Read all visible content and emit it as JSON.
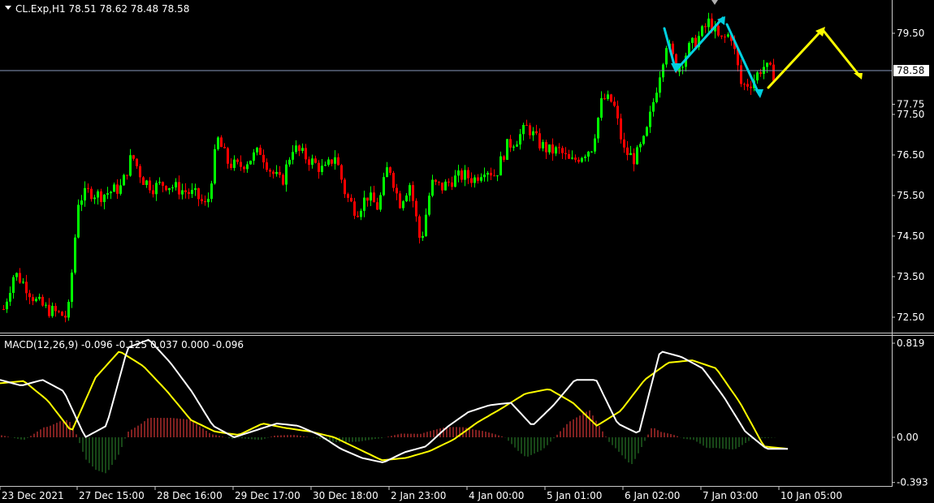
{
  "header": {
    "symbol_info": "CL.Exp,H1  78.51 78.62 78.48 78.58",
    "macd_info": "MACD(12,26,9) -0.096 -0.125 0.037 0.000 -0.096"
  },
  "price_axis": {
    "ticks": [
      "79.50",
      "77.75",
      "77.50",
      "76.50",
      "75.50",
      "74.50",
      "73.50",
      "72.50"
    ],
    "tick_values": [
      79.5,
      77.75,
      77.5,
      76.5,
      75.5,
      74.5,
      73.5,
      72.5
    ],
    "current_price_label": "78.58",
    "current_price": 78.58
  },
  "macd_axis": {
    "ticks": [
      "0.819",
      "0.00",
      "-0.393"
    ],
    "tick_values": [
      0.819,
      0.0,
      -0.393
    ]
  },
  "time_axis": {
    "labels": [
      "23 Dec 2021",
      "27 Dec 15:00",
      "28 Dec 16:00",
      "29 Dec 17:00",
      "30 Dec 18:00",
      "2 Jan 23:00",
      "4 Jan 00:00",
      "5 Jan 01:00",
      "6 Jan 02:00",
      "7 Jan 03:00",
      "10 Jan 05:00"
    ]
  },
  "colors": {
    "background": "#000000",
    "bull_candle": "#00ff00",
    "bear_candle": "#ff0000",
    "macd_line": "#ffffff",
    "signal_line": "#ffff00",
    "hist_positive": "#ff4040",
    "hist_negative": "#2e8b2e",
    "cyan_arrow": "#00d0e0",
    "yellow_arrow": "#ffff00",
    "price_line": "#8899bb",
    "grid": "#c8c8c8"
  },
  "chart_data": {
    "type": "candlestick",
    "price_path": [
      72.7,
      73.6,
      73.3,
      72.9,
      72.7,
      72.6,
      72.5,
      75.4,
      75.6,
      75.5,
      75.6,
      75.7,
      76.5,
      75.9,
      75.7,
      75.8,
      75.7,
      75.6,
      75.5,
      75.2,
      76.9,
      76.3,
      76.2,
      76.4,
      76.6,
      76.1,
      75.8,
      76.7,
      76.5,
      76.3,
      76.1,
      76.5,
      75.5,
      75.1,
      75.5,
      75.2,
      76.3,
      75.3,
      75.8,
      74.3,
      75.8,
      75.7,
      75.9,
      76.0,
      75.9,
      76.2,
      76.0,
      76.7,
      76.9,
      77.2,
      76.8,
      76.6,
      76.6,
      76.3,
      76.5,
      76.7,
      77.9,
      77.8,
      76.6,
      76.4,
      76.9,
      78.1,
      79.3,
      78.6,
      79.1,
      79.4,
      79.8,
      79.3,
      79.5,
      78.2,
      78.3,
      78.7,
      78.5
    ],
    "macd_path": [
      0.5,
      0.45,
      0.5,
      0.4,
      0.0,
      0.1,
      0.78,
      0.85,
      0.65,
      0.4,
      0.1,
      0.0,
      0.06,
      0.12,
      0.1,
      0.02,
      -0.1,
      -0.18,
      -0.22,
      -0.13,
      -0.08,
      0.09,
      0.22,
      0.28,
      0.3,
      0.1,
      0.28,
      0.5,
      0.5,
      0.12,
      0.03,
      0.75,
      0.7,
      0.6,
      0.35,
      0.05,
      -0.1,
      -0.1
    ],
    "signal_path": [
      0.47,
      0.49,
      0.32,
      0.05,
      0.52,
      0.75,
      0.62,
      0.4,
      0.15,
      0.05,
      0.02,
      0.12,
      0.08,
      0.05,
      0.0,
      -0.1,
      -0.2,
      -0.18,
      -0.12,
      -0.02,
      0.13,
      0.25,
      0.38,
      0.42,
      0.3,
      0.1,
      0.23,
      0.5,
      0.65,
      0.67,
      0.6,
      0.3,
      -0.08,
      -0.1
    ]
  }
}
